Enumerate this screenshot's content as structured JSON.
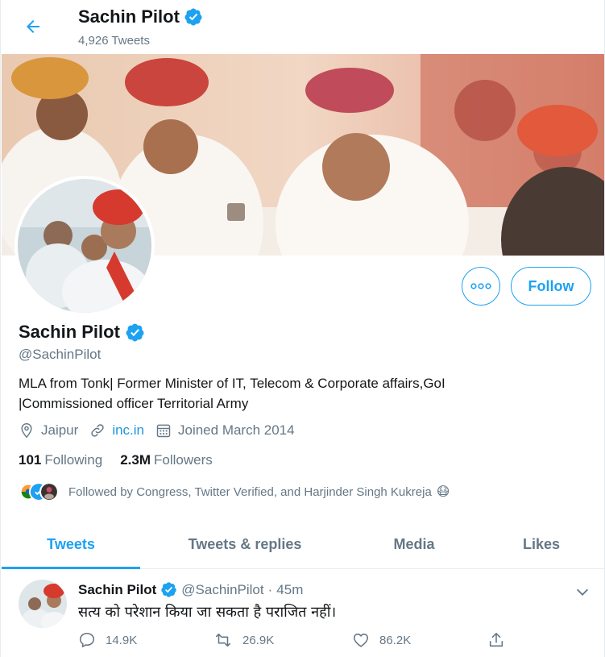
{
  "header": {
    "name": "Sachin Pilot",
    "tweet_count": "4,926 Tweets",
    "back_icon": "arrow-left-icon"
  },
  "profile": {
    "name": "Sachin Pilot",
    "handle": "@SachinPilot",
    "bio_line1": "MLA from Tonk| Former Minister of IT, Telecom & Corporate affairs,GoI",
    "bio_line2": "|Commissioned officer Territorial Army",
    "location": "Jaipur",
    "website": "inc.in",
    "joined": "Joined March 2014",
    "following_count": "101",
    "following_label": "Following",
    "followers_count": "2.3M",
    "followers_label": "Followers",
    "followed_by": "Followed by Congress, Twitter Verified, and Harjinder Singh Kukreja",
    "followed_by_emoji": "😷"
  },
  "actions": {
    "follow_label": "Follow",
    "more_icon": "more-icon"
  },
  "tabs": [
    {
      "label": "Tweets",
      "active": true
    },
    {
      "label": "Tweets & replies",
      "active": false
    },
    {
      "label": "Media",
      "active": false
    },
    {
      "label": "Likes",
      "active": false
    }
  ],
  "tweet": {
    "name": "Sachin Pilot",
    "handle": "@SachinPilot",
    "separator": "·",
    "time": "45m",
    "text": "सत्य को परेशान किया जा सकता है पराजित नहीं।",
    "replies": "14.9K",
    "retweets": "26.9K",
    "likes": "86.2K"
  },
  "colors": {
    "accent": "#1da1f2",
    "secondary_text": "#657786",
    "primary_text": "#14171a",
    "verified": "#1da1f2"
  }
}
